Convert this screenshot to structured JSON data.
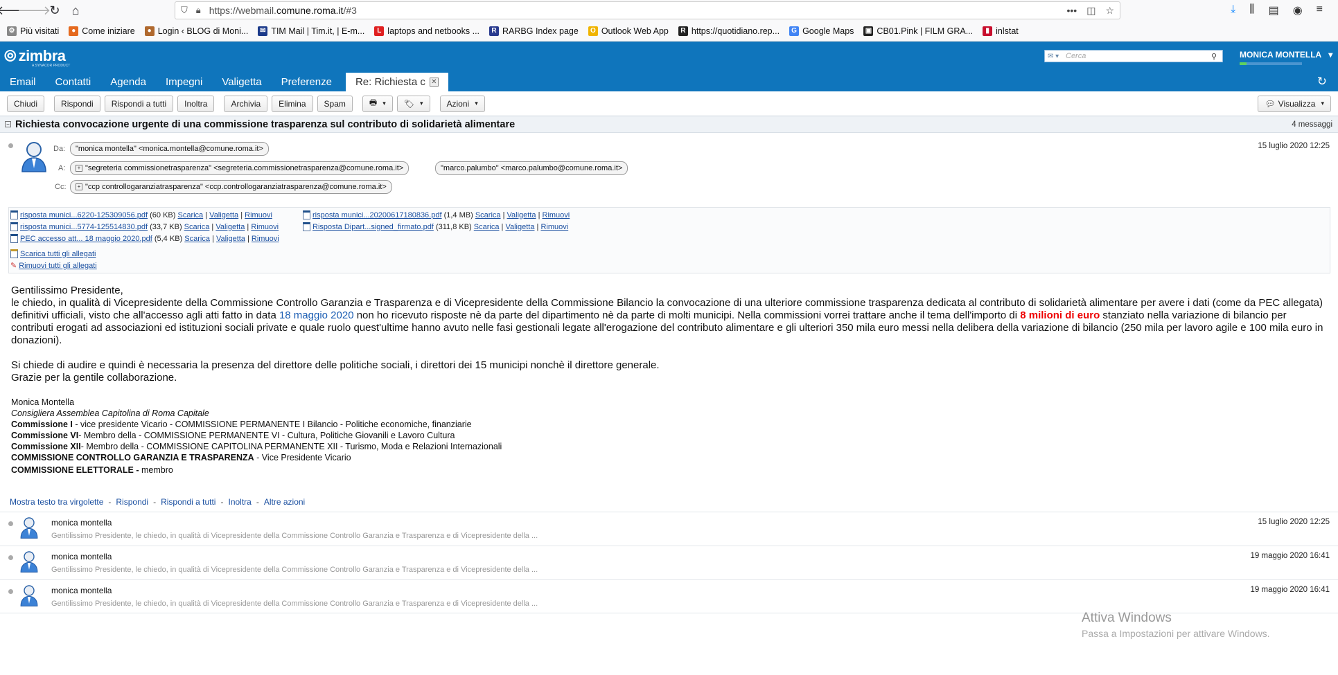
{
  "browser": {
    "url_prefix": "https://webmail.",
    "url_domain": "comune.roma.it",
    "url_suffix": "/#3",
    "url_more": "•••",
    "bookmarks": [
      {
        "label": "Più visitati",
        "color": "#888888",
        "glyph": "⚙"
      },
      {
        "label": "Come iniziare",
        "color": "#e56a1f",
        "glyph": "●"
      },
      {
        "label": "Login ‹ BLOG di Moni...",
        "color": "#b0692e",
        "glyph": "●"
      },
      {
        "label": "TIM Mail | Tim.it, | E-m...",
        "color": "#1b3a8a",
        "glyph": "✉"
      },
      {
        "label": "laptops and netbooks ...",
        "color": "#e02020",
        "glyph": "L"
      },
      {
        "label": "RARBG Index page",
        "color": "#2a3b8f",
        "glyph": "R"
      },
      {
        "label": "Outlook Web App",
        "color": "#f0b400",
        "glyph": "O"
      },
      {
        "label": "https://quotidiano.rep...",
        "color": "#222222",
        "glyph": "R"
      },
      {
        "label": "Google Maps",
        "color": "#4285f4",
        "glyph": "G"
      },
      {
        "label": "CB01.Pink | FILM GRA...",
        "color": "#222222",
        "glyph": "▣"
      },
      {
        "label": "inlstat",
        "color": "#c8102e",
        "glyph": "▮"
      }
    ]
  },
  "app": {
    "logo": "zimbra",
    "logo_sub": "A SYNACOR PRODUCT",
    "search_placeholder": "Cerca",
    "user_name": "MONICA MONTELLA",
    "tabs": [
      "Email",
      "Contatti",
      "Agenda",
      "Impegni",
      "Valigetta",
      "Preferenze"
    ],
    "active_tab": "Re: Richiesta c"
  },
  "toolbar": {
    "close": "Chiudi",
    "reply": "Rispondi",
    "reply_all": "Rispondi a tutti",
    "forward": "Inoltra",
    "archive": "Archivia",
    "delete": "Elimina",
    "spam": "Spam",
    "actions": "Azioni",
    "view": "Visualizza"
  },
  "conversation": {
    "title": "Richiesta convocazione urgente di una commissione trasparenza sul contributo di solidarietà alimentare",
    "count": "4 messaggi"
  },
  "message": {
    "from_label": "Da:",
    "to_label": "A:",
    "cc_label": "Cc:",
    "from": "\"monica montella\" <monica.montella@comune.roma.it>",
    "to1": "\"segreteria commissionetrasparenza\" <segreteria.commissionetrasparenza@comune.roma.it>",
    "to2": "\"marco.palumbo\" <marco.palumbo@comune.roma.it>",
    "cc": "\"ccp controllogaranziatrasparenza\" <ccp.controllogaranziatrasparenza@comune.roma.it>",
    "date": "15 luglio 2020 12:25"
  },
  "attachments": {
    "links": {
      "download": "Scarica",
      "briefcase": "Valigetta",
      "remove": "Rimuovi"
    },
    "items": [
      {
        "name": "risposta munici...6220-125309056.pdf",
        "size": "(60 KB)"
      },
      {
        "name": "risposta munici...5774-125514830.pdf",
        "size": "(33,7 KB)"
      },
      {
        "name": "PEC accesso att... 18 maggio 2020.pdf",
        "size": "(5,4 KB)"
      },
      {
        "name": "risposta munici...20200617180836.pdf",
        "size": "(1,4 MB)"
      },
      {
        "name": "Risposta Dipart...signed_firmato.pdf",
        "size": "(311,8 KB)"
      }
    ],
    "download_all": "Scarica tutti gli allegati",
    "remove_all": "Rimuovi tutti gli allegati"
  },
  "body": {
    "greeting": "Gentilissimo Presidente,",
    "p1_a": "le chiedo, in qualità di Vicepresidente della Commissione Controllo Garanzia e Trasparenza e di Vicepresidente della Commissione Bilancio la convocazione di una ulteriore  commissione trasparenza dedicata al contributo di solidarietà alimentare per avere i dati (come da PEC allegata) definitivi ufficiali, visto che all'accesso agli atti fatto in data ",
    "p1_date": "18 maggio 2020",
    "p1_b": " non ho ricevuto risposte nè da parte del dipartimento nè da parte di molti municipi. Nella commissioni vorrei trattare anche il tema dell'importo di ",
    "p1_amount": "8 milioni di euro",
    "p1_c": " stanziato nella variazione di bilancio per contributi erogati ad associazioni ed istituzioni sociali private e quale ruolo quest'ultime hanno avuto nelle fasi gestionali legate all'erogazione del contributo alimentare e gli ulteriori 350 mila euro messi nella delibera della variazione di bilancio (250 mila per lavoro agile e 100 mila euro in donazioni).",
    "p2": "Si chiede di audire e quindi è necessaria la presenza del direttore delle politiche sociali, i direttori dei 15 municipi nonchè il direttore generale.",
    "p3": "Grazie per la gentile collaborazione.",
    "sig_name": "Monica Montella",
    "sig_role": "Consigliera Assemblea Capitolina di Roma Capitale",
    "sig_lines": [
      {
        "b": "Commissione I",
        "t": " - vice presidente Vicario - COMMISSIONE PERMANENTE I Bilancio - Politiche economiche, finanziarie"
      },
      {
        "b": "Commissione VI",
        "t": "- Membro della - COMMISSIONE PERMANENTE VI - Cultura, Politiche Giovanili e Lavoro Cultura"
      },
      {
        "b": "Commissione XII",
        "t": "- Membro della - COMMISSIONE CAPITOLINA PERMANENTE XII - Turismo, Moda e Relazioni Internazionali"
      },
      {
        "b": "COMMISSIONE CONTROLLO GARANZIA E TRASPARENZA",
        "t": " - Vice Presidente Vicario"
      },
      {
        "b": "COMMISSIONE ELETTORALE -",
        "t": " membro"
      }
    ]
  },
  "msg_actions": [
    "Mostra testo tra virgolette",
    "Rispondi",
    "Rispondi a tutti",
    "Inoltra",
    "Altre azioni"
  ],
  "collapsed": [
    {
      "from": "monica montella",
      "snippet": "Gentilissimo Presidente, le chiedo, in qualità di Vicepresidente della Commissione Controllo Garanzia e Trasparenza e di Vicepresidente della ...",
      "date": "15 luglio 2020 12:25"
    },
    {
      "from": "monica montella",
      "snippet": "Gentilissimo Presidente, le chiedo, in qualità di Vicepresidente della Commissione Controllo Garanzia e Trasparenza e di Vicepresidente della ...",
      "date": "19 maggio 2020 16:41"
    },
    {
      "from": "monica montella",
      "snippet": "Gentilissimo Presidente, le chiedo, in qualità di Vicepresidente della Commissione Controllo Garanzia e Trasparenza e di Vicepresidente della ...",
      "date": "19 maggio 2020 16:41"
    }
  ],
  "watermark": {
    "title": "Attiva Windows",
    "subtitle": "Passa a Impostazioni per attivare Windows."
  }
}
